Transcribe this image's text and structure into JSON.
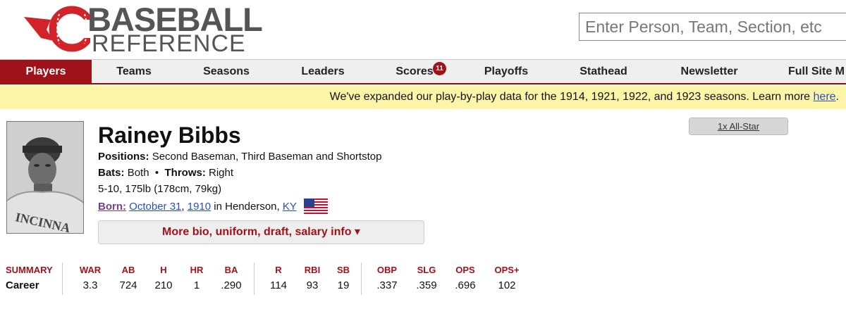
{
  "logo": {
    "line1": "BASEBALL",
    "line2": "REFERENCE"
  },
  "search": {
    "placeholder": "Enter Person, Team, Section, etc"
  },
  "nav": {
    "items": [
      {
        "label": "Players"
      },
      {
        "label": "Teams"
      },
      {
        "label": "Seasons"
      },
      {
        "label": "Leaders"
      },
      {
        "label": "Scores"
      },
      {
        "label": "Playoffs"
      },
      {
        "label": "Stathead"
      },
      {
        "label": "Newsletter"
      },
      {
        "label": "Full Site M"
      }
    ],
    "scores_badge": "11"
  },
  "alert": {
    "text": "We've expanded our play-by-play data for the 1914, 1921, 1922, and 1923 seasons. Learn more ",
    "link": "here",
    "end": "."
  },
  "player": {
    "name": "Rainey Bibbs",
    "positions_label": "Positions:",
    "positions": "Second Baseman, Third Baseman and Shortstop",
    "bats_label": "Bats:",
    "bats": "Both",
    "sep": "•",
    "throws_label": "Throws:",
    "throws": "Right",
    "size": "5-10, 175lb (178cm, 79kg)",
    "born_label": "Born:",
    "born_date": "October 31",
    "born_comma": ",",
    "born_year": "1910",
    "born_place": "in Henderson,",
    "born_state": "KY",
    "photo_text": "INCINNA",
    "allstar": "1x All-Star",
    "more_bio": "More bio, uniform, draft, salary info ▾"
  },
  "stats": {
    "headers": [
      "SUMMARY",
      "WAR",
      "AB",
      "H",
      "HR",
      "BA",
      "R",
      "RBI",
      "SB",
      "OBP",
      "SLG",
      "OPS",
      "OPS+"
    ],
    "career": [
      "Career",
      "3.3",
      "724",
      "210",
      "1",
      ".290",
      "114",
      "93",
      "19",
      ".337",
      ".359",
      ".696",
      "102"
    ]
  },
  "colors": {
    "brand": "#a01219",
    "alert_bg": "#fdf6a8",
    "nav_bg": "#efefef"
  }
}
